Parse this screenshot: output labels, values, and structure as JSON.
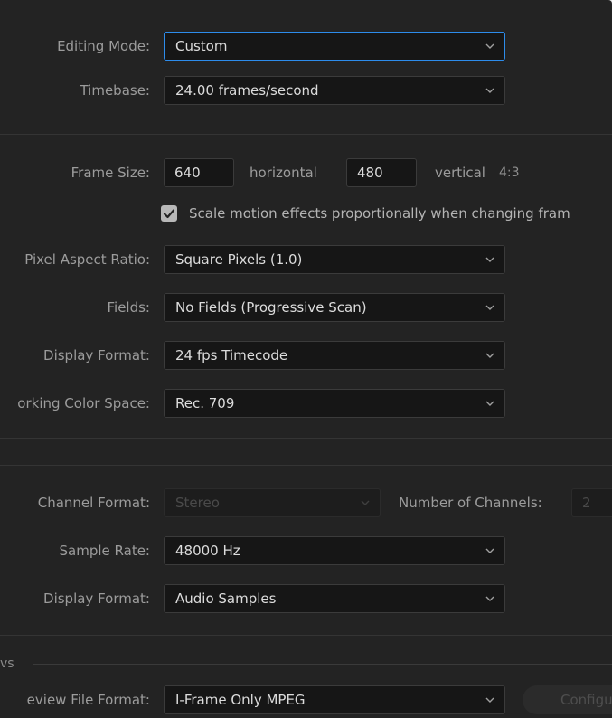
{
  "video": {
    "editing_mode_label": "Editing Mode:",
    "editing_mode_value": "Custom",
    "timebase_label": "Timebase:",
    "timebase_value": "24.00  frames/second",
    "frame_size_label": "Frame Size:",
    "frame_width": "640",
    "horizontal_label": "horizontal",
    "frame_height": "480",
    "vertical_label": "vertical",
    "aspect_ratio_text": "4:3",
    "scale_motion_label": "Scale motion effects proportionally when changing fram",
    "scale_motion_checked": true,
    "pixel_aspect_label": "Pixel Aspect Ratio:",
    "pixel_aspect_value": "Square Pixels (1.0)",
    "fields_label": "Fields:",
    "fields_value": "No Fields (Progressive Scan)",
    "display_format_label": "Display Format:",
    "display_format_value": "24 fps Timecode",
    "color_space_label": "orking Color Space:",
    "color_space_value": "Rec. 709"
  },
  "audio": {
    "channel_format_label": "Channel Format:",
    "channel_format_value": "Stereo",
    "num_channels_label": "Number of Channels:",
    "num_channels_value": "2",
    "sample_rate_label": "Sample Rate:",
    "sample_rate_value": "48000 Hz",
    "display_format_label": "Display Format:",
    "display_format_value": "Audio Samples"
  },
  "previews": {
    "section_label": "vs",
    "file_format_label": "eview File Format:",
    "file_format_value": "I-Frame Only MPEG",
    "configure_label": "Configu"
  },
  "colors": {
    "panel_bg": "#232323",
    "field_bg": "#161616",
    "focus_accent": "#2d8ceb",
    "label_text": "#9c9c9c",
    "value_text": "#dcdcdc"
  }
}
